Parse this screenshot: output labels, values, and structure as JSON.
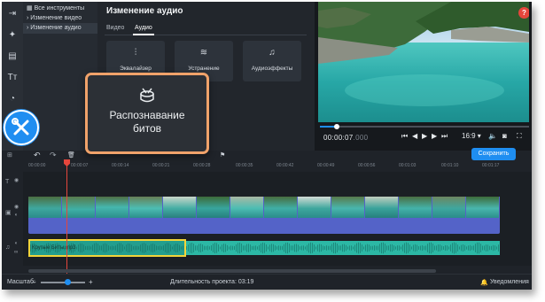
{
  "sidebar": {
    "tree": [
      "Все инструменты",
      "Изменение видео",
      "Изменение аудио"
    ]
  },
  "audio_panel": {
    "title": "Изменение аудио",
    "tabs": [
      "Видео",
      "Аудио"
    ],
    "active_tab": "Аудио",
    "cards": [
      {
        "label": "Эквалайзер",
        "icon": "equalizer-icon"
      },
      {
        "label": "Устранение",
        "icon": "noise-removal-icon"
      },
      {
        "label": "Аудиоэффекты",
        "icon": "audio-effects-icon"
      }
    ]
  },
  "callout": {
    "line1": "Распознавание",
    "line2": "битов",
    "icon": "drum-icon"
  },
  "preview": {
    "help": "?",
    "timecode_main": "00:00:07",
    "timecode_frac": ".000",
    "aspect": "16:9",
    "playback_position": 0.08
  },
  "timeline": {
    "save_label": "Сохранить",
    "ruler": [
      "00:00:00",
      "00:00:07",
      "00:00:14",
      "00:00:21",
      "00:00:28",
      "00:00:35",
      "00:00:42",
      "00:00:49",
      "00:00:56",
      "00:01:03",
      "00:01:10",
      "00:01:17"
    ],
    "audio_clip": "Крутые Биты.mp3",
    "audio_selected": true
  },
  "status": {
    "scale_label": "Масштаб:",
    "scale_level": 0.6,
    "duration_label": "Длительность проекта: 03:19",
    "notifications": "Уведомления"
  },
  "colors": {
    "accent": "#1f8ef1",
    "callout_border": "#f0a26a",
    "playhead": "#e5463c",
    "audio": "#2cb8a5",
    "video_track": "#5463c8",
    "selection": "#f1d43a"
  }
}
